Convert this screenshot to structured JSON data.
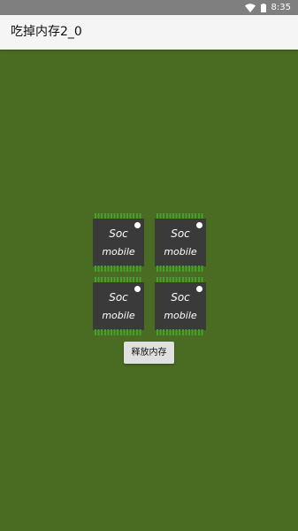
{
  "status_bar": {
    "time": "8:35",
    "icons": [
      "wifi-icon",
      "battery-icon"
    ]
  },
  "app_bar": {
    "title": "吃掉内存2_0"
  },
  "chips": [
    {
      "label1": "Soc",
      "label2": "mobile"
    },
    {
      "label1": "Soc",
      "label2": "mobile"
    },
    {
      "label1": "Soc",
      "label2": "mobile"
    },
    {
      "label1": "Soc",
      "label2": "mobile"
    }
  ],
  "release_button": {
    "label": "释放内存"
  },
  "colors": {
    "background": "#4a6b22",
    "status_bar": "#7f7f7f",
    "app_bar": "#f5f5f5",
    "chip_body": "#3a3a3a",
    "chip_pins": "#46a02c",
    "button": "#e0e0e0"
  }
}
